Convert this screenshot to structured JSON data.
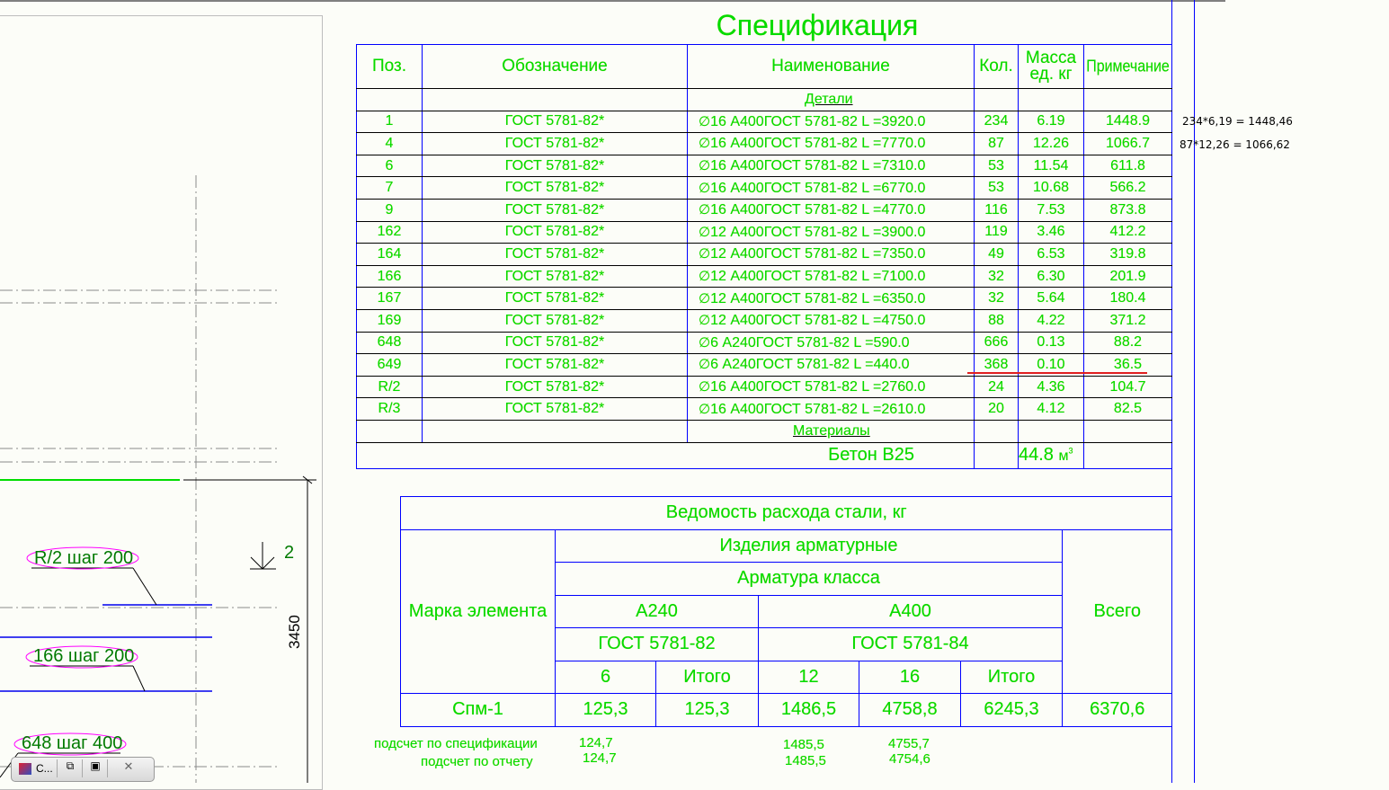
{
  "spec": {
    "title": "Спецификация",
    "headers": {
      "pos": "Поз.",
      "designation": "Обозначение",
      "name": "Наименование",
      "qty": "Кол.",
      "mass": "Масса ед. кг",
      "note": "Примечание"
    },
    "section_parts": "Детали",
    "section_materials": "Материалы",
    "rows": [
      {
        "pos": "1",
        "designation": "ГОСТ 5781-82*",
        "name": "16 А400ГОСТ 5781-82  L =3920.0",
        "qty": "234",
        "mass": "6.19",
        "note": "1448.9"
      },
      {
        "pos": "4",
        "designation": "ГОСТ 5781-82*",
        "name": "16 А400ГОСТ 5781-82  L =7770.0",
        "qty": "87",
        "mass": "12.26",
        "note": "1066.7"
      },
      {
        "pos": "6",
        "designation": "ГОСТ 5781-82*",
        "name": "16 А400ГОСТ 5781-82  L =7310.0",
        "qty": "53",
        "mass": "11.54",
        "note": "611.8"
      },
      {
        "pos": "7",
        "designation": "ГОСТ 5781-82*",
        "name": "16 А400ГОСТ 5781-82  L =6770.0",
        "qty": "53",
        "mass": "10.68",
        "note": "566.2"
      },
      {
        "pos": "9",
        "designation": "ГОСТ 5781-82*",
        "name": "16 А400ГОСТ 5781-82  L =4770.0",
        "qty": "116",
        "mass": "7.53",
        "note": "873.8"
      },
      {
        "pos": "162",
        "designation": "ГОСТ 5781-82*",
        "name": "12 А400ГОСТ 5781-82  L =3900.0",
        "qty": "119",
        "mass": "3.46",
        "note": "412.2"
      },
      {
        "pos": "164",
        "designation": "ГОСТ 5781-82*",
        "name": "12 А400ГОСТ 5781-82  L =7350.0",
        "qty": "49",
        "mass": "6.53",
        "note": "319.8"
      },
      {
        "pos": "166",
        "designation": "ГОСТ 5781-82*",
        "name": "12 А400ГОСТ 5781-82  L =7100.0",
        "qty": "32",
        "mass": "6.30",
        "note": "201.9"
      },
      {
        "pos": "167",
        "designation": "ГОСТ 5781-82*",
        "name": "12 А400ГОСТ 5781-82  L =6350.0",
        "qty": "32",
        "mass": "5.64",
        "note": "180.4"
      },
      {
        "pos": "169",
        "designation": "ГОСТ 5781-82*",
        "name": "12 А400ГОСТ 5781-82  L =4750.0",
        "qty": "88",
        "mass": "4.22",
        "note": "371.2"
      },
      {
        "pos": "648",
        "designation": "ГОСТ 5781-82*",
        "name": "6 А240ГОСТ 5781-82  L =590.0",
        "qty": "666",
        "mass": "0.13",
        "note": "88.2"
      },
      {
        "pos": "649",
        "designation": "ГОСТ 5781-82*",
        "name": "6 А240ГОСТ 5781-82  L =440.0",
        "qty": "368",
        "mass": "0.10",
        "note": "36.5"
      },
      {
        "pos": "R/2",
        "designation": "ГОСТ 5781-82*",
        "name": "16 А400ГОСТ 5781-82  L =2760.0",
        "qty": "24",
        "mass": "4.36",
        "note": "104.7"
      },
      {
        "pos": "R/3",
        "designation": "ГОСТ 5781-82*",
        "name": "16 А400ГОСТ 5781-82  L =2610.0",
        "qty": "20",
        "mass": "4.12",
        "note": "82.5"
      }
    ],
    "diameter_symbol": "∅",
    "concrete_name": "Бетон В25",
    "concrete_volume": "44.8",
    "concrete_unit": "м",
    "concrete_unit_sup": "3"
  },
  "calc_notes": [
    "234*6,19 = 1448,46",
    "87*12,26 = 1066,62"
  ],
  "steel": {
    "title": "Ведомость расхода стали, кг",
    "mark_header": "Марка элемента",
    "products": "Изделия арматурные",
    "rebar_class": "Арматура класса",
    "class_a240": "А240",
    "class_a400": "А400",
    "gost_a240": "ГОСТ 5781-82",
    "gost_a400": "ГОСТ 5781-84",
    "total_header": "Всего",
    "sub": [
      "6",
      "Итого",
      "12",
      "16",
      "Итого"
    ],
    "row": {
      "mark": "Спм-1",
      "values": [
        "125,3",
        "125,3",
        "1486,5",
        "4758,8",
        "6245,3"
      ],
      "total": "6370,6"
    }
  },
  "checks": {
    "by_spec_label": "подсчет по спецификации",
    "by_report_label": "подсчет по отчету",
    "by_spec": [
      "124,7",
      "1485,5",
      "4755,7"
    ],
    "by_report": [
      "124,7",
      "1485,5",
      "4754,6"
    ]
  },
  "drawing": {
    "labels": [
      "R/2 шаг 200",
      "166 шаг 200",
      "648 шаг 400"
    ],
    "section_mark": "2",
    "dimension": "3450"
  },
  "taskbar": {
    "window_label": "C..."
  }
}
